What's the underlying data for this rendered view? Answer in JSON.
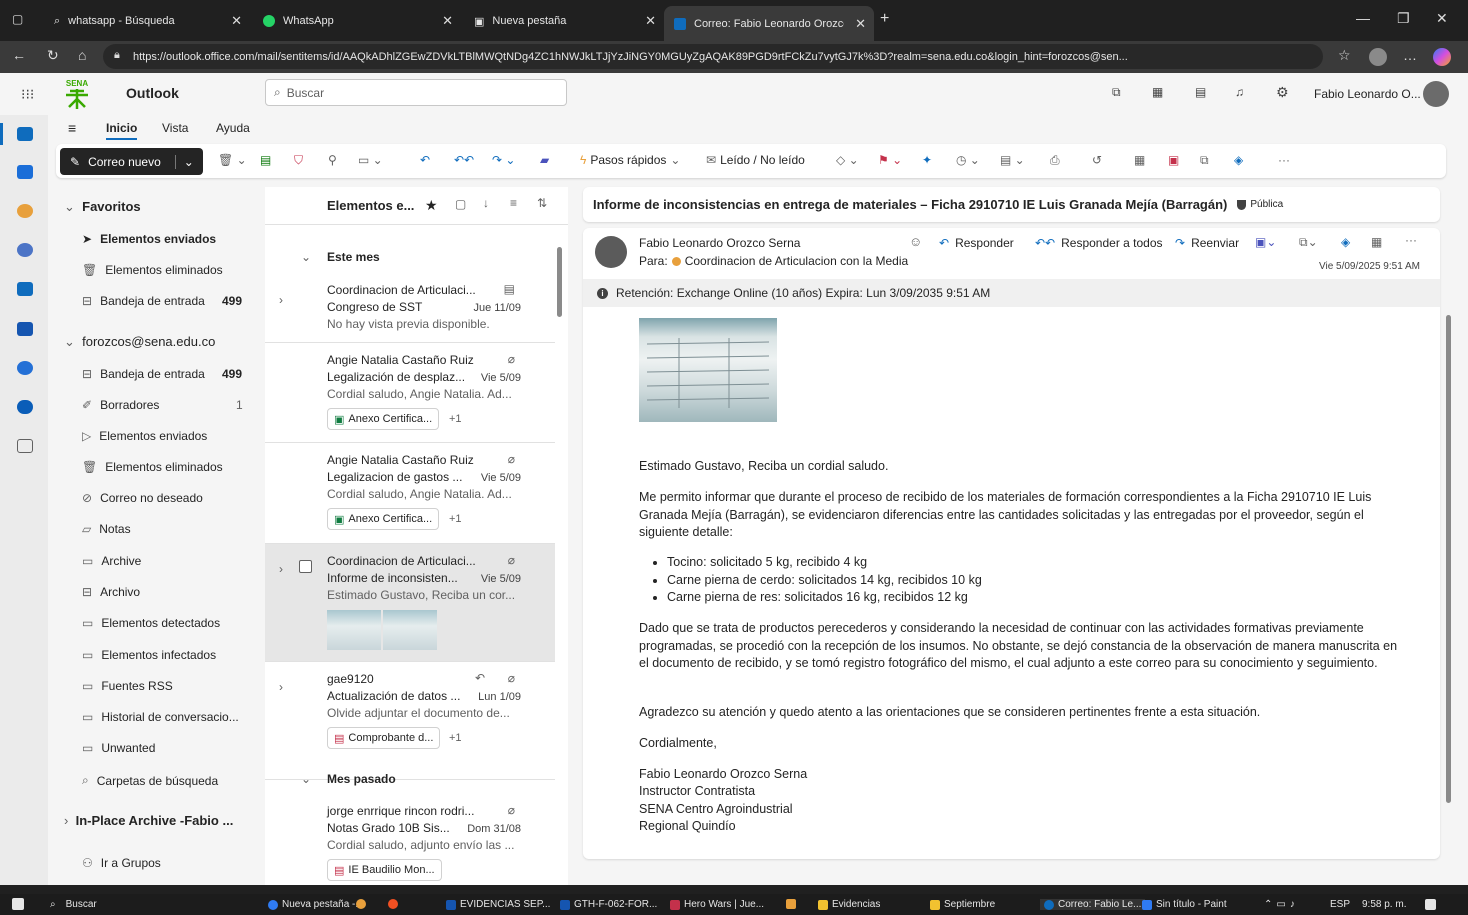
{
  "browser": {
    "tabs": [
      {
        "title": "whatsapp - Búsqueda"
      },
      {
        "title": "WhatsApp"
      },
      {
        "title": "Nueva pestaña"
      },
      {
        "title": "Correo: Fabio Leonardo Orozco S"
      }
    ],
    "url": "https://outlook.office.com/mail/sentitems/id/AAQkADhlZGEwZDVkLTBlMWQtNDg4ZC1hNWJkLTJjYzJiNGY0MGUyZgAQAK89PGD9rtFCkZu7vytGJ7k%3D?realm=sena.edu.co&login_hint=forozcos@sen..."
  },
  "app": {
    "brand": "SENA",
    "name": "Outlook",
    "search_placeholder": "Buscar",
    "user_name": "Fabio Leonardo O..."
  },
  "ribbon": {
    "tabs": [
      "Inicio",
      "Vista",
      "Ayuda"
    ],
    "new_mail": "Correo nuevo",
    "quick_steps": "Pasos rápidos",
    "read_unread": "Leído / No leído"
  },
  "folders": {
    "favorites_title": "Favoritos",
    "favorites": [
      {
        "label": "Elementos enviados",
        "count": ""
      },
      {
        "label": "Elementos eliminados",
        "count": ""
      },
      {
        "label": "Bandeja de entrada",
        "count": "499"
      }
    ],
    "account_title": "forozcos@sena.edu.co",
    "account_items": [
      {
        "label": "Bandeja de entrada",
        "count": "499"
      },
      {
        "label": "Borradores",
        "count": "1"
      },
      {
        "label": "Elementos enviados",
        "count": ""
      },
      {
        "label": "Elementos eliminados",
        "count": ""
      },
      {
        "label": "Correo no deseado",
        "count": ""
      },
      {
        "label": "Notas",
        "count": ""
      },
      {
        "label": "Archive",
        "count": ""
      },
      {
        "label": "Archivo",
        "count": ""
      },
      {
        "label": "Elementos detectados",
        "count": ""
      },
      {
        "label": "Elementos infectados",
        "count": ""
      },
      {
        "label": "Fuentes RSS",
        "count": ""
      },
      {
        "label": "Historial de conversacio...",
        "count": ""
      },
      {
        "label": "Unwanted",
        "count": ""
      },
      {
        "label": "Carpetas de búsqueda",
        "count": ""
      }
    ],
    "archive_title": "In-Place Archive -Fabio ...",
    "groups_link": "Ir a Grupos"
  },
  "message_list": {
    "title": "Elementos e...",
    "group_this_month": "Este mes",
    "group_last_month": "Mes pasado",
    "items": [
      {
        "sender": "Coordinacion de Articulaci...",
        "subject": "Congreso de SST",
        "date": "Jue 11/09",
        "preview": "No hay vista previa disponible.",
        "attachment": "",
        "extra": ""
      },
      {
        "sender": "Angie Natalia Castaño Ruiz",
        "subject": "Legalización de desplaz...",
        "date": "Vie 5/09",
        "preview": "Cordial saludo, Angie Natalia. Ad...",
        "attachment": "Anexo Certifica...",
        "extra": "+1"
      },
      {
        "sender": "Angie Natalia Castaño Ruiz",
        "subject": "Legalizacion de gastos ...",
        "date": "Vie 5/09",
        "preview": "Cordial saludo, Angie Natalia. Ad...",
        "attachment": "Anexo Certifica...",
        "extra": "+1"
      },
      {
        "sender": "Coordinacion de Articulaci...",
        "subject": "Informe de inconsisten...",
        "date": "Vie 5/09",
        "preview": "Estimado Gustavo, Reciba un cor...",
        "attachment": "",
        "extra": ""
      },
      {
        "sender": "gae9120",
        "subject": "Actualización de datos ...",
        "date": "Lun 1/09",
        "preview": "Olvide adjuntar el documento de...",
        "attachment": "Comprobante d...",
        "extra": "+1"
      },
      {
        "sender": "jorge enrrique rincon rodri...",
        "subject": "Notas Grado 10B Sis...",
        "date": "Dom 31/08",
        "preview": "Cordial saludo, adjunto envío las ...",
        "attachment": "IE Baudilio Mon...",
        "extra": ""
      }
    ]
  },
  "reading": {
    "subject": "Informe de inconsistencias en entrega de materiales – Ficha 2910710 IE Luis Granada Mejía (Barragán)",
    "sensitivity": "Pública",
    "from": "Fabio Leonardo Orozco Serna",
    "to_label": "Para:",
    "to": "Coordinacion de Articulacion con la Media",
    "date": "Vie 5/09/2025 9:51 AM",
    "actions": {
      "reply": "Responder",
      "reply_all": "Responder a todos",
      "forward": "Reenviar"
    },
    "retention": "Retención: Exchange Online (10 años) Expira: Lun 3/09/2035 9:51 AM",
    "greeting": "Estimado Gustavo, Reciba un cordial saludo.",
    "para1": "Me permito informar que durante el proceso de recibido de los materiales de formación correspondientes a la Ficha 2910710 IE Luis Granada Mejía (Barragán), se evidenciaron diferencias entre las cantidades solicitadas y las entregadas por el proveedor, según el siguiente detalle:",
    "bullets": [
      "Tocino: solicitado 5 kg, recibido 4 kg",
      "Carne pierna de cerdo: solicitados 14 kg, recibidos 10 kg",
      "Carne pierna de res: solicitados 16 kg, recibidos 12 kg"
    ],
    "para2": "Dado que se trata de productos perecederos y considerando la necesidad de continuar con las actividades formativas previamente programadas, se procedió con la recepción de los insumos. No obstante, se dejó constancia de la observación de manera manuscrita en el documento de recibido, y se tomó registro fotográfico del mismo, el cual adjunto a este correo para su conocimiento y seguimiento.",
    "para3": "Agradezco su atención y quedo atento a las orientaciones que se consideren pertinentes frente a esta situación.",
    "closing": "Cordialmente,",
    "signature": [
      "Fabio Leonardo Orozco Serna",
      "Instructor Contratista",
      "SENA Centro Agroindustrial",
      "Regional Quindío"
    ]
  },
  "taskbar": {
    "search": "Buscar",
    "apps": [
      "Nueva pestaña -...",
      "EVIDENCIAS SEP...",
      "GTH-F-062-FOR...",
      "Hero Wars | Jue...",
      "Evidencias",
      "Septiembre",
      "Correo: Fabio Le...",
      "Sin título - Paint"
    ],
    "lang": "ESP",
    "time": "9:58 p. m."
  }
}
